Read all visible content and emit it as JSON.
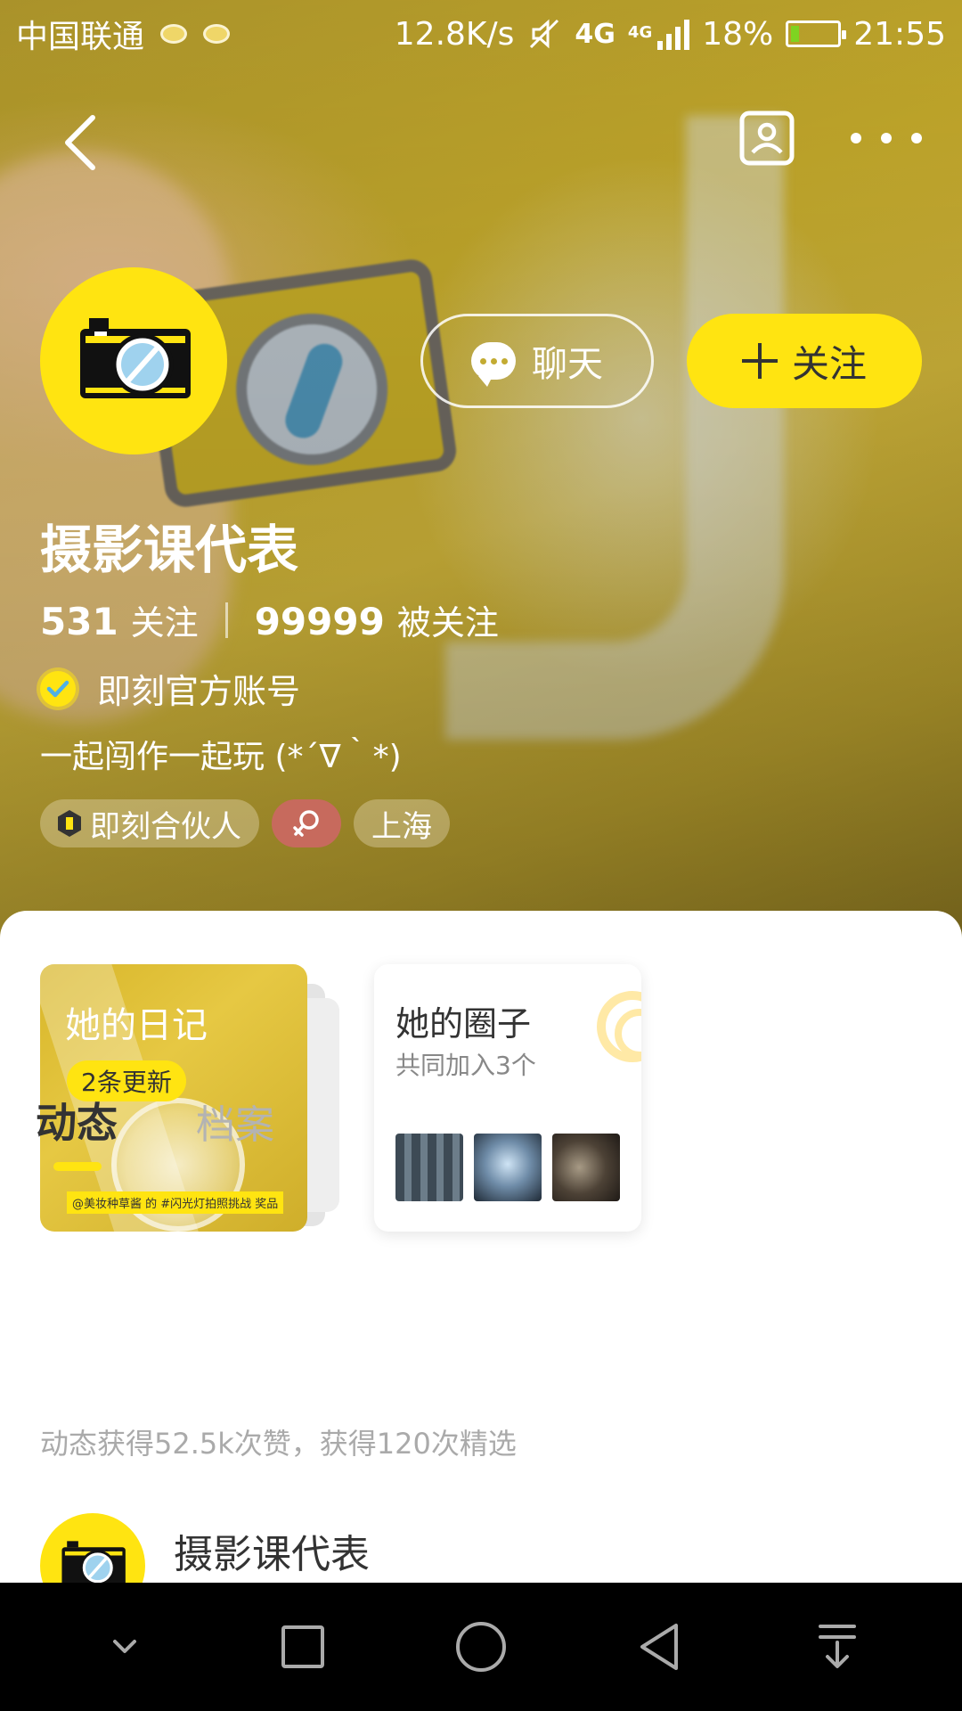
{
  "status_bar": {
    "carrier": "中国联通",
    "speed": "12.8K/s",
    "network": "4G",
    "network_small": "4G",
    "battery_pct": "18%",
    "battery_level": 0.18,
    "time": "21:55"
  },
  "profile": {
    "name": "摄影课代表",
    "following_count": "531",
    "following_label": "关注",
    "followers_count": "99999",
    "followers_label": "被关注",
    "official_label": "即刻官方账号",
    "bio": "一起闯作一起玩 (*´∇｀*)",
    "tags": {
      "partner": "即刻合伙人",
      "location": "上海"
    },
    "chat_label": "聊天",
    "follow_label": "关注"
  },
  "cards": {
    "diary": {
      "title": "她的日记",
      "badge": "2条更新",
      "caption": "@美妆种草酱 的 #闪光灯拍照挑战 奖品"
    },
    "circle": {
      "title": "她的圈子",
      "subtitle": "共同加入3个"
    }
  },
  "tabs": {
    "active": "动态",
    "inactive": "档案"
  },
  "feed": {
    "stats": "动态获得52.5k次赞，获得120次精选",
    "item_name": "摄影课代表"
  },
  "colors": {
    "accent": "#ffe411",
    "gender_tag": "#c76a5d"
  }
}
